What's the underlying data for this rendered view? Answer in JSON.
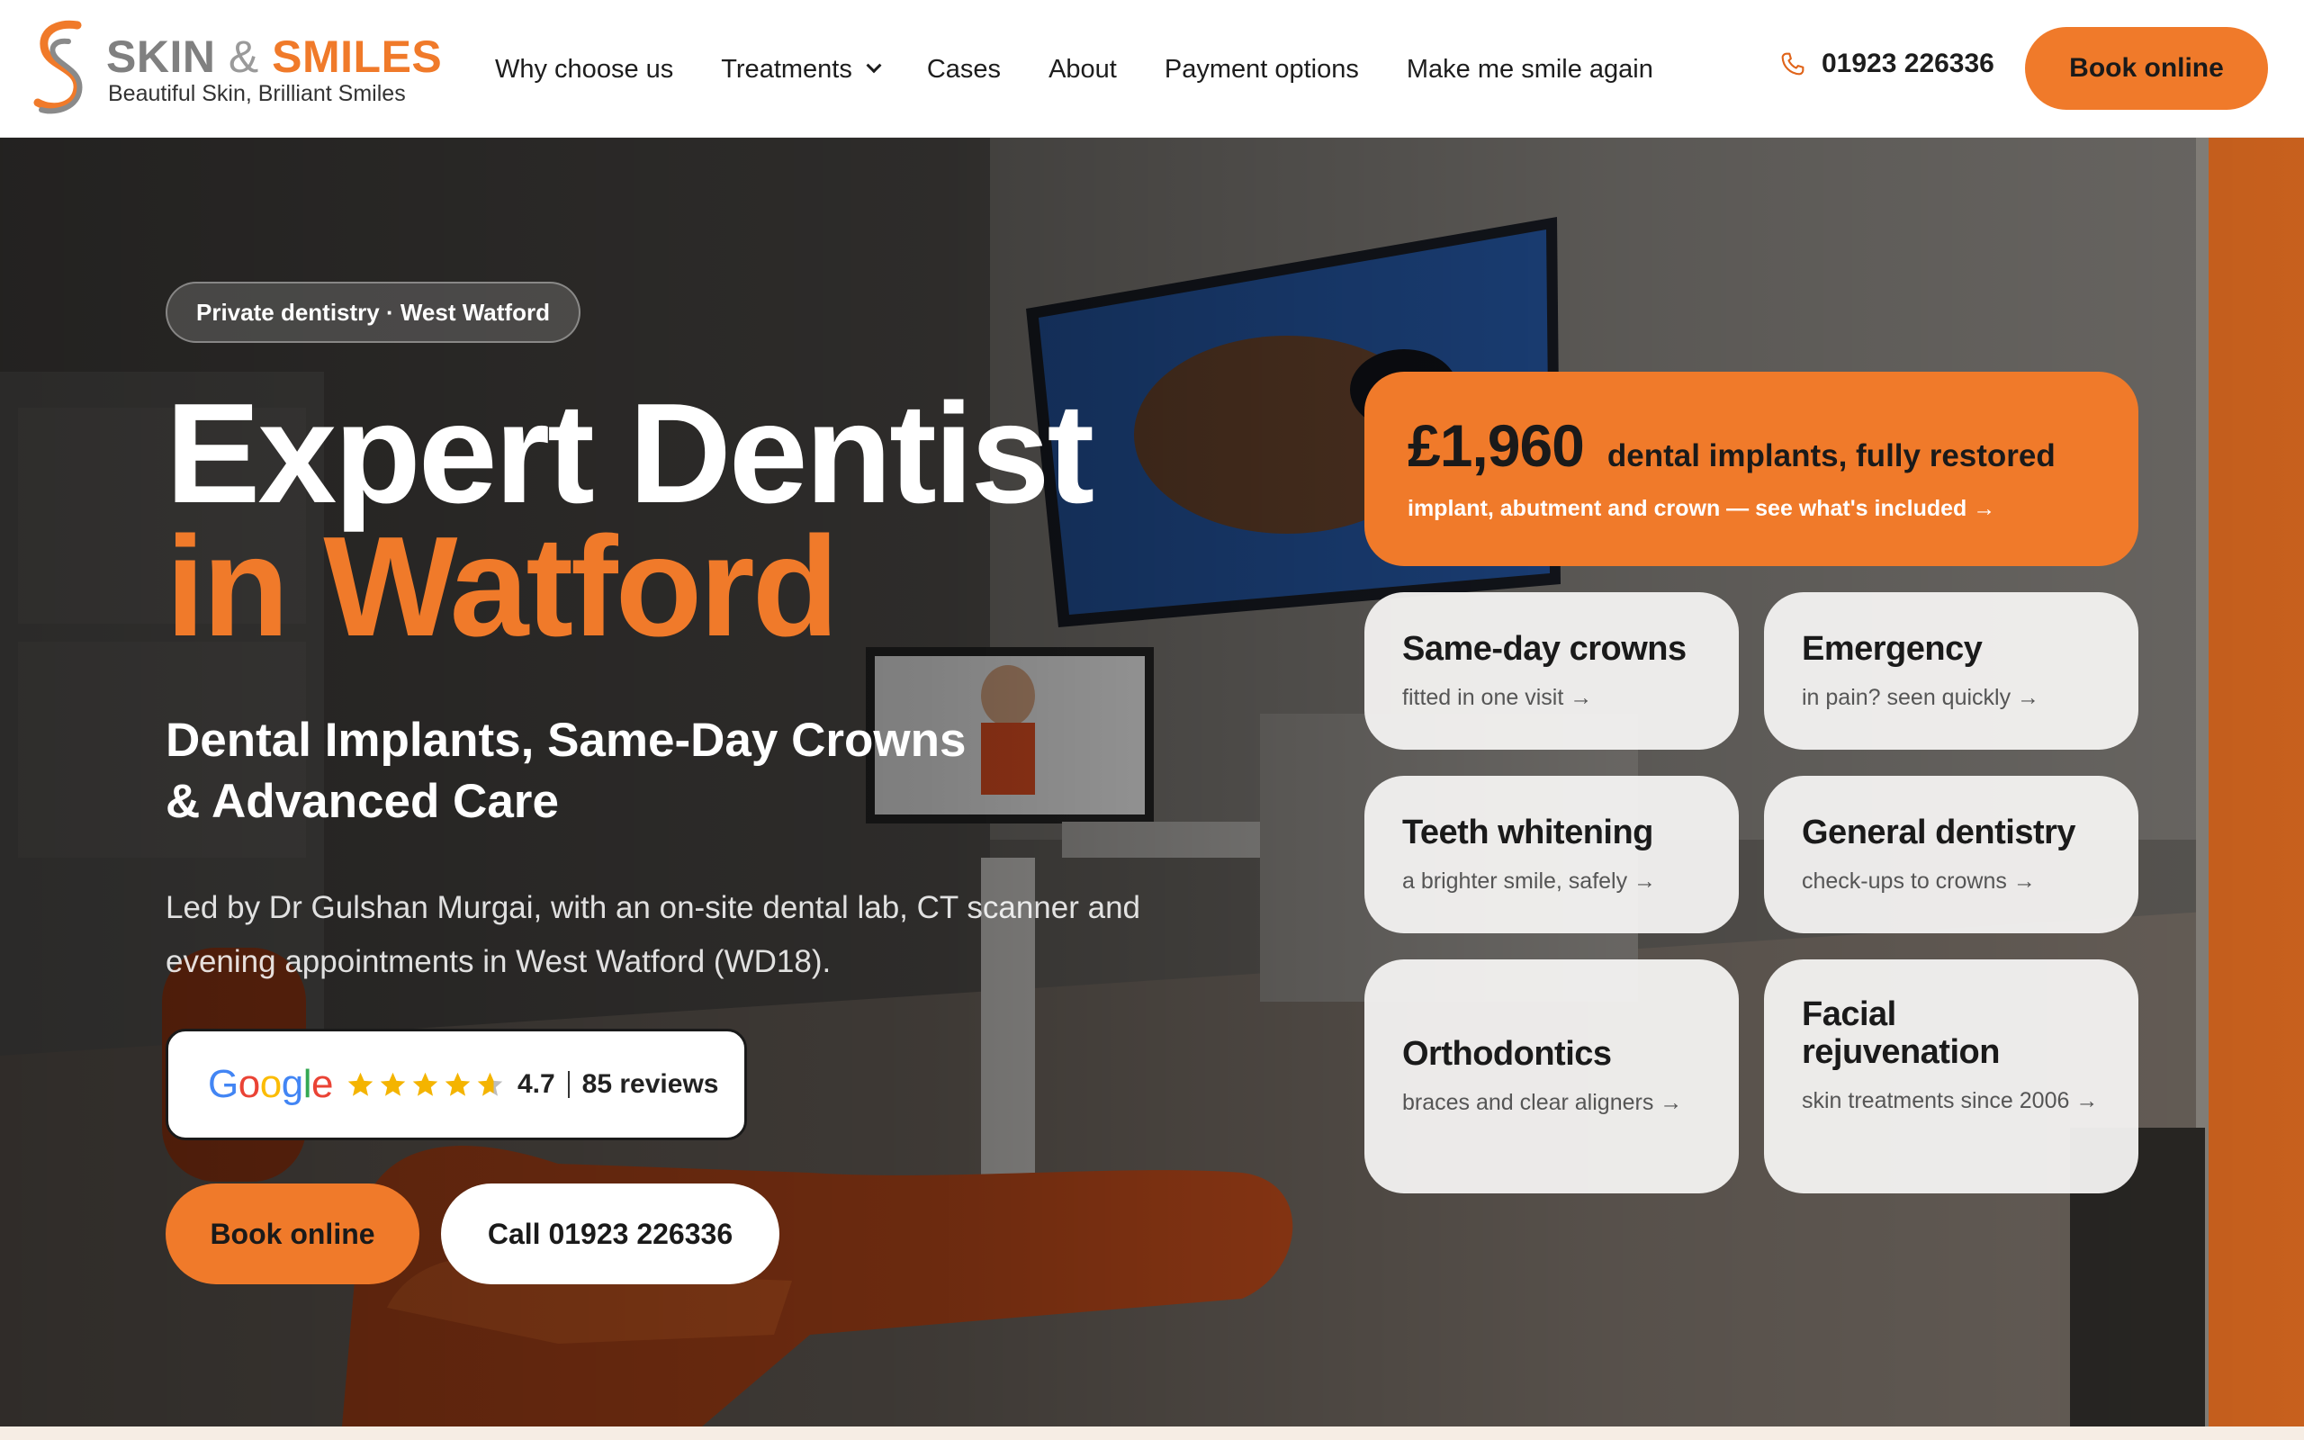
{
  "brand": {
    "name_part1": "SKIN",
    "name_amp": "&",
    "name_part2": "SMILES",
    "tagline": "Beautiful Skin, Brilliant Smiles",
    "colors": {
      "orange": "#f07a2a",
      "grey": "#808080",
      "dark": "#1a1a1a"
    }
  },
  "nav": {
    "items": [
      {
        "label": "Why choose us"
      },
      {
        "label": "Treatments",
        "has_dropdown": true
      },
      {
        "label": "Cases"
      },
      {
        "label": "About"
      },
      {
        "label": "Payment options"
      },
      {
        "label": "Make me smile again"
      }
    ],
    "phone_icon": "phone-icon",
    "phone": "01923 226336",
    "book_label": "Book online"
  },
  "hero": {
    "pill": "Private dentistry · West Watford",
    "heading_line1": "Expert Dentist",
    "heading_line2": "in Watford",
    "subheading": "Dental Implants, Same-Day Crowns & Advanced Care",
    "lead": "Led by Dr Gulshan Murgai, with an on-site dental lab, CT scanner and evening appointments in West Watford (WD18).",
    "reviews": {
      "brand": "Google",
      "rating": "4.7",
      "stars": 4.7,
      "count_label": "85 reviews"
    },
    "book_label": "Book online",
    "call_label": "Call 01923 226336"
  },
  "offer": {
    "price": "£1,960",
    "title": "dental implants, fully restored",
    "subtitle": "implant, abutment and crown — see what's included →"
  },
  "services": [
    {
      "title": "Same-day crowns",
      "subtitle": "fitted in one visit →"
    },
    {
      "title": "Emergency",
      "subtitle": "in pain? seen quickly →"
    },
    {
      "title": "Teeth whitening",
      "subtitle": "a brighter smile, safely →"
    },
    {
      "title": "General dentistry",
      "subtitle": "check-ups to crowns →"
    },
    {
      "title": "Orthodontics",
      "subtitle": "braces and clear aligners →"
    },
    {
      "title": "Facial rejuvenation",
      "subtitle": "skin treatments since 2006 →"
    }
  ]
}
